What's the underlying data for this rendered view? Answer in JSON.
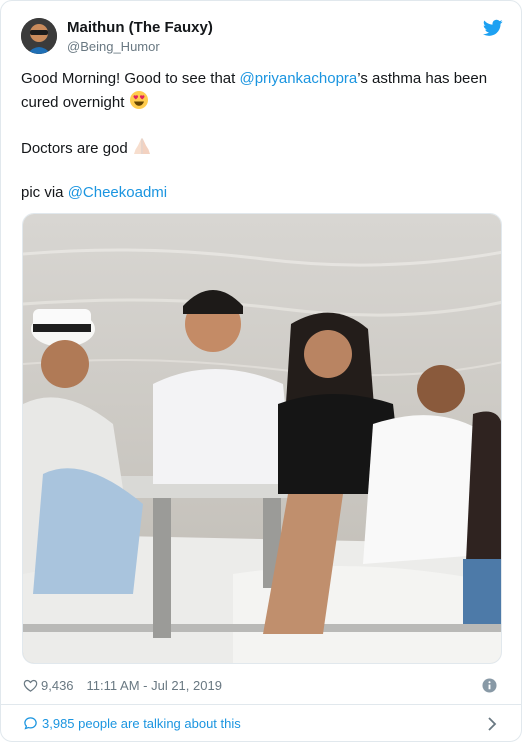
{
  "header": {
    "display_name": "Maithun (The Fauxy)",
    "handle": "@Being_Humor",
    "platform_icon": "twitter-bird-icon"
  },
  "tweet": {
    "line1_before": "Good Morning! Good to see that ",
    "mention1": "@priyankachopra",
    "line1_after": "’s asthma has been cured overnight ",
    "emoji1": "heart-eyes-emoji",
    "line2": "Doctors are god ",
    "emoji2": "folded-hands-emoji",
    "line3_before": "pic via ",
    "mention2": "@Cheekoadmi"
  },
  "meta": {
    "likes": "9,436",
    "timestamp": "11:11 AM - Jul 21, 2019",
    "info_icon": "info-icon"
  },
  "footer": {
    "conversation_text": "3,985 people are talking about this"
  },
  "colors": {
    "link": "#1b95e0",
    "text": "#14171a",
    "muted": "#697882",
    "border": "#e1e8ed"
  }
}
